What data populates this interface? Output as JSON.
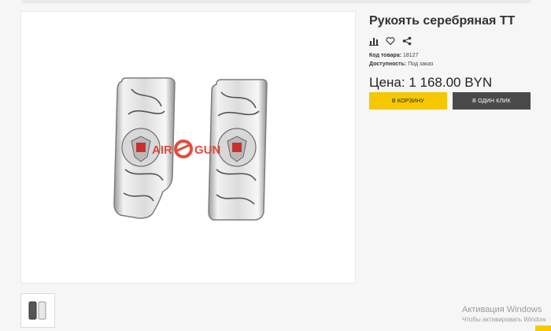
{
  "product": {
    "title": "Рукоять серебряная ТТ",
    "code_label": "Код товара:",
    "code_value": "18127",
    "availability_label": "Доступность:",
    "availability_value": "Под заказ",
    "price": "Цена: 1 168.00 BYN"
  },
  "actions": {
    "icons": [
      "compare-icon",
      "heart-icon",
      "share-icon"
    ],
    "add_to_cart": "В КОРЗИНУ",
    "one_click": "В ОДИН КЛИК"
  },
  "image": {
    "logo_left": "AIR",
    "logo_right": "GUN"
  },
  "os_watermark": {
    "line1": "Активация Windows",
    "line2": "Чтобы активировать Window"
  },
  "colors": {
    "accent": "#f5c800",
    "dark_button": "#4a4a4a",
    "logo_red": "#e03a2a"
  }
}
